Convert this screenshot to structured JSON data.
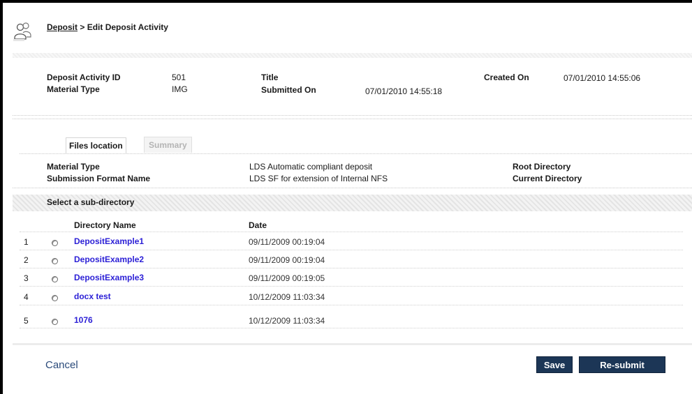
{
  "breadcrumb": {
    "link": "Deposit",
    "separator": " > ",
    "current": "Edit Deposit Activity"
  },
  "header_icon": "users-icon",
  "info": {
    "deposit_activity_id_label": "Deposit Activity ID",
    "deposit_activity_id_value": "501",
    "material_type_label": "Material Type",
    "material_type_value": "IMG",
    "title_label": "Title",
    "title_value": "",
    "submitted_on_label": "Submitted On",
    "submitted_on_value": "07/01/2010 14:55:18",
    "created_on_label": "Created On",
    "created_on_value": "07/01/2010 14:55:06"
  },
  "tabs": [
    {
      "label": "Files location",
      "active": true
    },
    {
      "label": "Summary",
      "active": false
    }
  ],
  "files_location": {
    "material_type_label": "Material Type",
    "material_type_value": "LDS Automatic compliant deposit",
    "submission_format_label": "Submission Format Name",
    "submission_format_value": "LDS SF for extension of Internal NFS",
    "root_directory_label": "Root Directory",
    "current_directory_label": "Current Directory"
  },
  "subdirectory": {
    "title": "Select a sub-directory",
    "columns": {
      "name": "Directory Name",
      "date": "Date"
    },
    "rows": [
      {
        "num": "1",
        "name": "DepositExample1",
        "date": "09/11/2009 00:19:04"
      },
      {
        "num": "2",
        "name": "DepositExample2",
        "date": "09/11/2009 00:19:04"
      },
      {
        "num": "3",
        "name": "DepositExample3",
        "date": "09/11/2009 00:19:05"
      },
      {
        "num": "4",
        "name": "docx test",
        "date": "10/12/2009 11:03:34"
      },
      {
        "num": "5",
        "name": "1076",
        "date": "10/12/2009 11:03:34"
      }
    ]
  },
  "footer": {
    "cancel_label": "Cancel",
    "save_label": "Save",
    "resubmit_label": "Re-submit"
  },
  "colors": {
    "button_bg": "#1c3656",
    "link": "#2b1fd6",
    "cancel": "#2a4a7a"
  }
}
